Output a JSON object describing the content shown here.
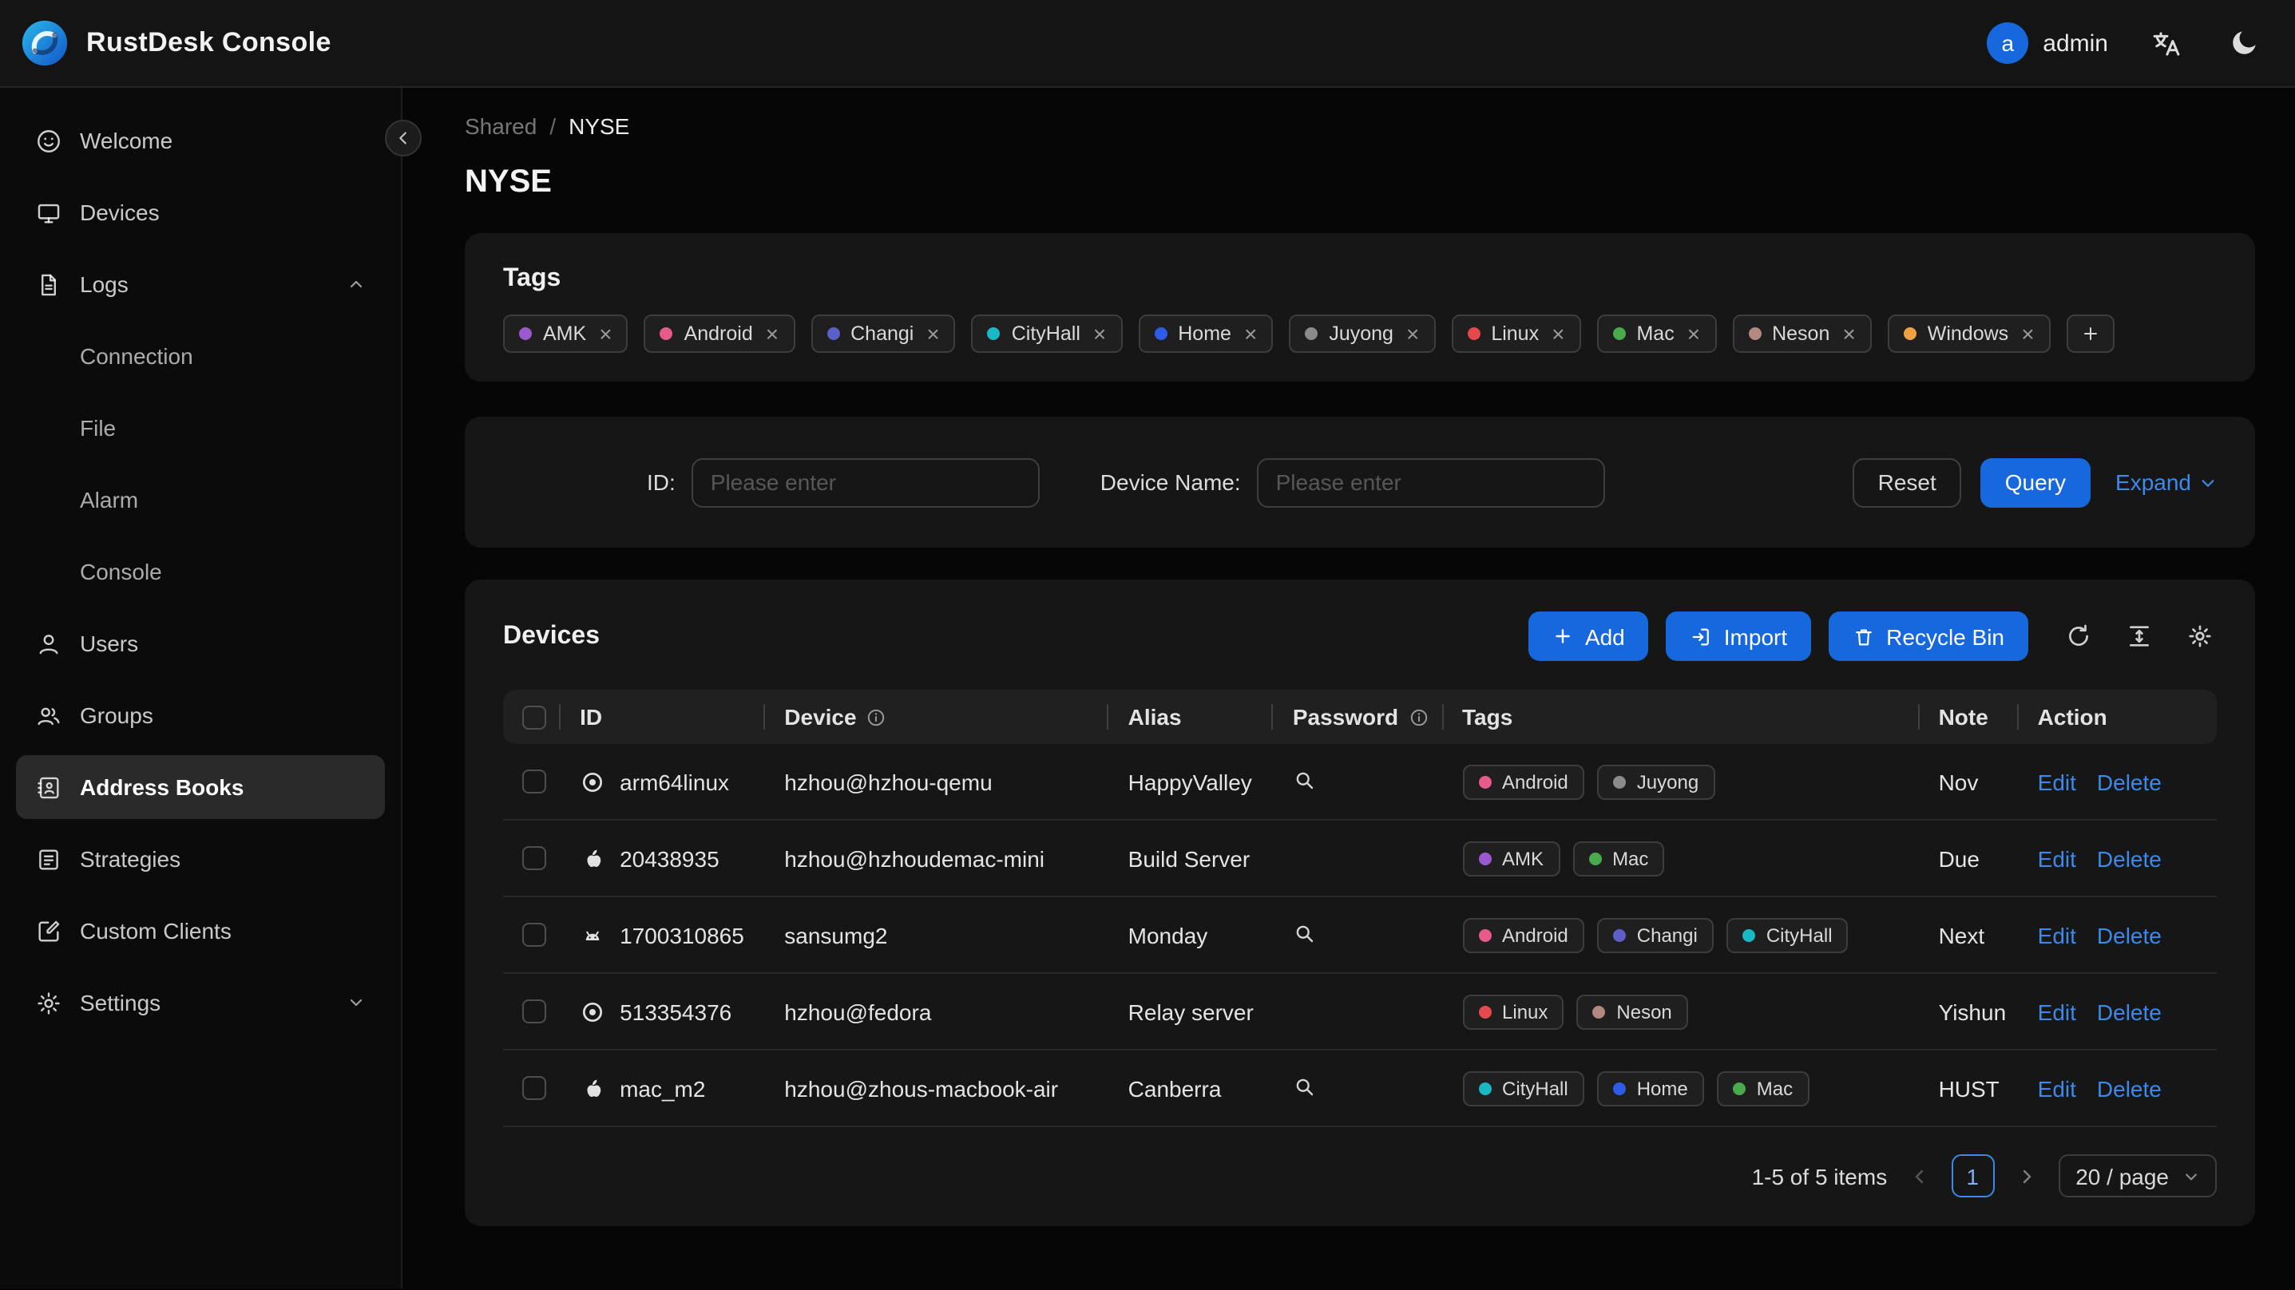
{
  "header": {
    "app_title": "RustDesk Console",
    "user_initial": "a",
    "user_name": "admin"
  },
  "sidebar": {
    "items": [
      "Welcome",
      "Devices",
      "Logs",
      "Connection",
      "File",
      "Alarm",
      "Console",
      "Users",
      "Groups",
      "Address Books",
      "Strategies",
      "Custom Clients",
      "Settings"
    ]
  },
  "breadcrumb": {
    "parent": "Shared",
    "separator": "/",
    "current": "NYSE"
  },
  "page_title": "NYSE",
  "tags_card": {
    "title": "Tags",
    "tags": [
      "AMK",
      "Android",
      "Changi",
      "CityHall",
      "Home",
      "Juyong",
      "Linux",
      "Mac",
      "Neson",
      "Windows"
    ]
  },
  "tag_colors": {
    "AMK": "#9b59d0",
    "Android": "#e75a8b",
    "Changi": "#5b5fc7",
    "CityHall": "#18b8c4",
    "Home": "#2e5ce6",
    "Juyong": "#8b8b8b",
    "Linux": "#e5484d",
    "Mac": "#49aa4d",
    "Neson": "#b38880",
    "Windows": "#f2a044"
  },
  "filter": {
    "id_label": "ID:",
    "device_name_label": "Device Name:",
    "placeholder": "Please enter",
    "reset": "Reset",
    "query": "Query",
    "expand": "Expand"
  },
  "devices_card": {
    "title": "Devices",
    "add": "Add",
    "import": "Import",
    "recycle_bin": "Recycle Bin",
    "columns": {
      "id": "ID",
      "device": "Device",
      "alias": "Alias",
      "password": "Password",
      "tags": "Tags",
      "note": "Note",
      "action": "Action"
    },
    "rows": [
      {
        "id": "arm64linux",
        "device": "hzhou@hzhou-qemu",
        "alias": "HappyValley",
        "tags": [
          "Android",
          "Juyong"
        ],
        "note": "Nov"
      },
      {
        "id": "20438935",
        "device": "hzhou@hzhoudemac-mini",
        "alias": "Build Server",
        "tags": [
          "AMK",
          "Mac"
        ],
        "note": "Due"
      },
      {
        "id": "1700310865",
        "device": "sansumg2",
        "alias": "Monday",
        "tags": [
          "Android",
          "Changi",
          "CityHall"
        ],
        "note": "Next"
      },
      {
        "id": "513354376",
        "device": "hzhou@fedora",
        "alias": "Relay server",
        "tags": [
          "Linux",
          "Neson"
        ],
        "note": "Yishun"
      },
      {
        "id": "mac_m2",
        "device": "hzhou@zhous-macbook-air",
        "alias": "Canberra",
        "tags": [
          "CityHall",
          "Home",
          "Mac"
        ],
        "note": "HUST"
      }
    ],
    "edit": "Edit",
    "delete": "Delete",
    "pagination": {
      "summary": "1-5 of 5 items",
      "page": "1",
      "page_size": "20 / page"
    }
  },
  "colors": {
    "primary": "#1668dc",
    "link": "#3c89e8"
  }
}
